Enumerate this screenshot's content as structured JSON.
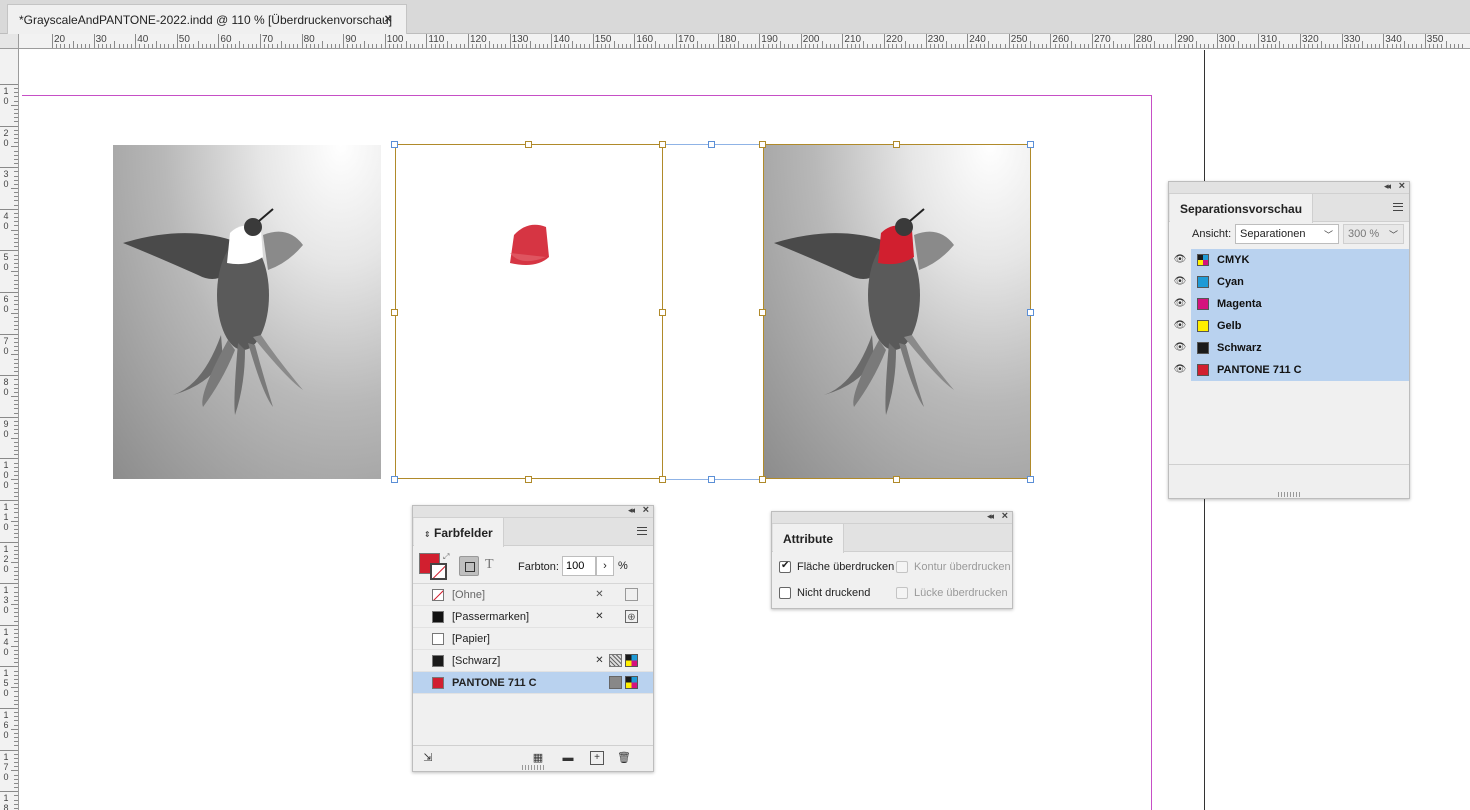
{
  "document": {
    "tab_title": "*GrayscaleAndPANTONE-2022.indd @ 110 % [Überdruckenvorschau]",
    "close_glyph": "×"
  },
  "ruler": {
    "h_labels": [
      "20",
      "30",
      "40",
      "50",
      "60",
      "70",
      "80",
      "90",
      "100",
      "110",
      "120",
      "130",
      "140",
      "150",
      "160",
      "170",
      "180",
      "190",
      "200",
      "210",
      "220",
      "230",
      "240",
      "250",
      "260",
      "270",
      "280",
      "290",
      "300",
      "310",
      "320",
      "330",
      "340",
      "350"
    ],
    "v_labels": [
      [
        "1",
        "0"
      ],
      [
        "2",
        "0"
      ],
      [
        "3",
        "0"
      ],
      [
        "4",
        "0"
      ],
      [
        "5",
        "0"
      ],
      [
        "6",
        "0"
      ],
      [
        "7",
        "0"
      ],
      [
        "8",
        "0"
      ],
      [
        "9",
        "0"
      ],
      [
        "1",
        "0",
        "0"
      ],
      [
        "1",
        "1",
        "0"
      ],
      [
        "1",
        "2",
        "0"
      ],
      [
        "1",
        "3",
        "0"
      ],
      [
        "1",
        "4",
        "0"
      ],
      [
        "1",
        "5",
        "0"
      ],
      [
        "1",
        "6",
        "0"
      ],
      [
        "1",
        "7",
        "0"
      ],
      [
        "1",
        "8",
        "0"
      ]
    ]
  },
  "frames": [
    {
      "name": "grayscale-image",
      "description_icon": "hummingbird-grayscale"
    },
    {
      "name": "pantone-channel-image",
      "description_icon": "red-throat-patch"
    },
    {
      "name": "composite-image",
      "description_icon": "hummingbird-red-throat"
    }
  ],
  "separations_panel": {
    "title": "Separationsvorschau",
    "view_label": "Ansicht:",
    "view_value": "Separationen",
    "zoom_value": "300 %",
    "rows": [
      {
        "name": "CMYK",
        "swatch": "cmyk-icon"
      },
      {
        "name": "Cyan",
        "color": "#1e9ad6"
      },
      {
        "name": "Magenta",
        "color": "#d5127e"
      },
      {
        "name": "Gelb",
        "color": "#ffef00"
      },
      {
        "name": "Schwarz",
        "color": "#1a1a1a"
      },
      {
        "name": "PANTONE 711 C",
        "color": "#d11f2f"
      }
    ]
  },
  "swatches_panel": {
    "title": "Farbfelder",
    "tint_label": "Farbton:",
    "tint_value": "100",
    "tint_unit": "%",
    "mode_text_glyph": "T",
    "rows": [
      {
        "name": "[Ohne]",
        "chip": "none",
        "muted": true,
        "icons": [
          "no-edit-icon",
          "none-icon"
        ]
      },
      {
        "name": "[Passermarken]",
        "chip": "#111111",
        "muted": false,
        "icons": [
          "no-edit-icon",
          "registration-icon"
        ]
      },
      {
        "name": "[Papier]",
        "chip": "#ffffff",
        "muted": false,
        "icons": []
      },
      {
        "name": "[Schwarz]",
        "chip": "#1a1a1a",
        "muted": false,
        "icons": [
          "no-edit-icon",
          "process-icon",
          "cmyk-icon"
        ]
      },
      {
        "name": "PANTONE 711 C",
        "chip": "#d11f2f",
        "muted": false,
        "selected": true,
        "bold": true,
        "icons": [
          "spot-icon",
          "cmyk-icon"
        ]
      }
    ],
    "footer_icons": [
      "load-swatches-icon",
      "new-color-group-icon",
      "folder-icon",
      "new-swatch-icon",
      "trash-icon"
    ]
  },
  "attributes_panel": {
    "title": "Attribute",
    "options": [
      {
        "label": "Fläche überdrucken",
        "checked": true,
        "enabled": true
      },
      {
        "label": "Kontur überdrucken",
        "checked": false,
        "enabled": false
      },
      {
        "label": "Nicht druckend",
        "checked": false,
        "enabled": true
      },
      {
        "label": "Lücke überdrucken",
        "checked": false,
        "enabled": false
      }
    ]
  },
  "colors": {
    "pantone": "#d11f2f",
    "selection_blue": "#b9d2ef",
    "frame_gold": "#b08a2a",
    "page_margin": "#c64fc6"
  }
}
